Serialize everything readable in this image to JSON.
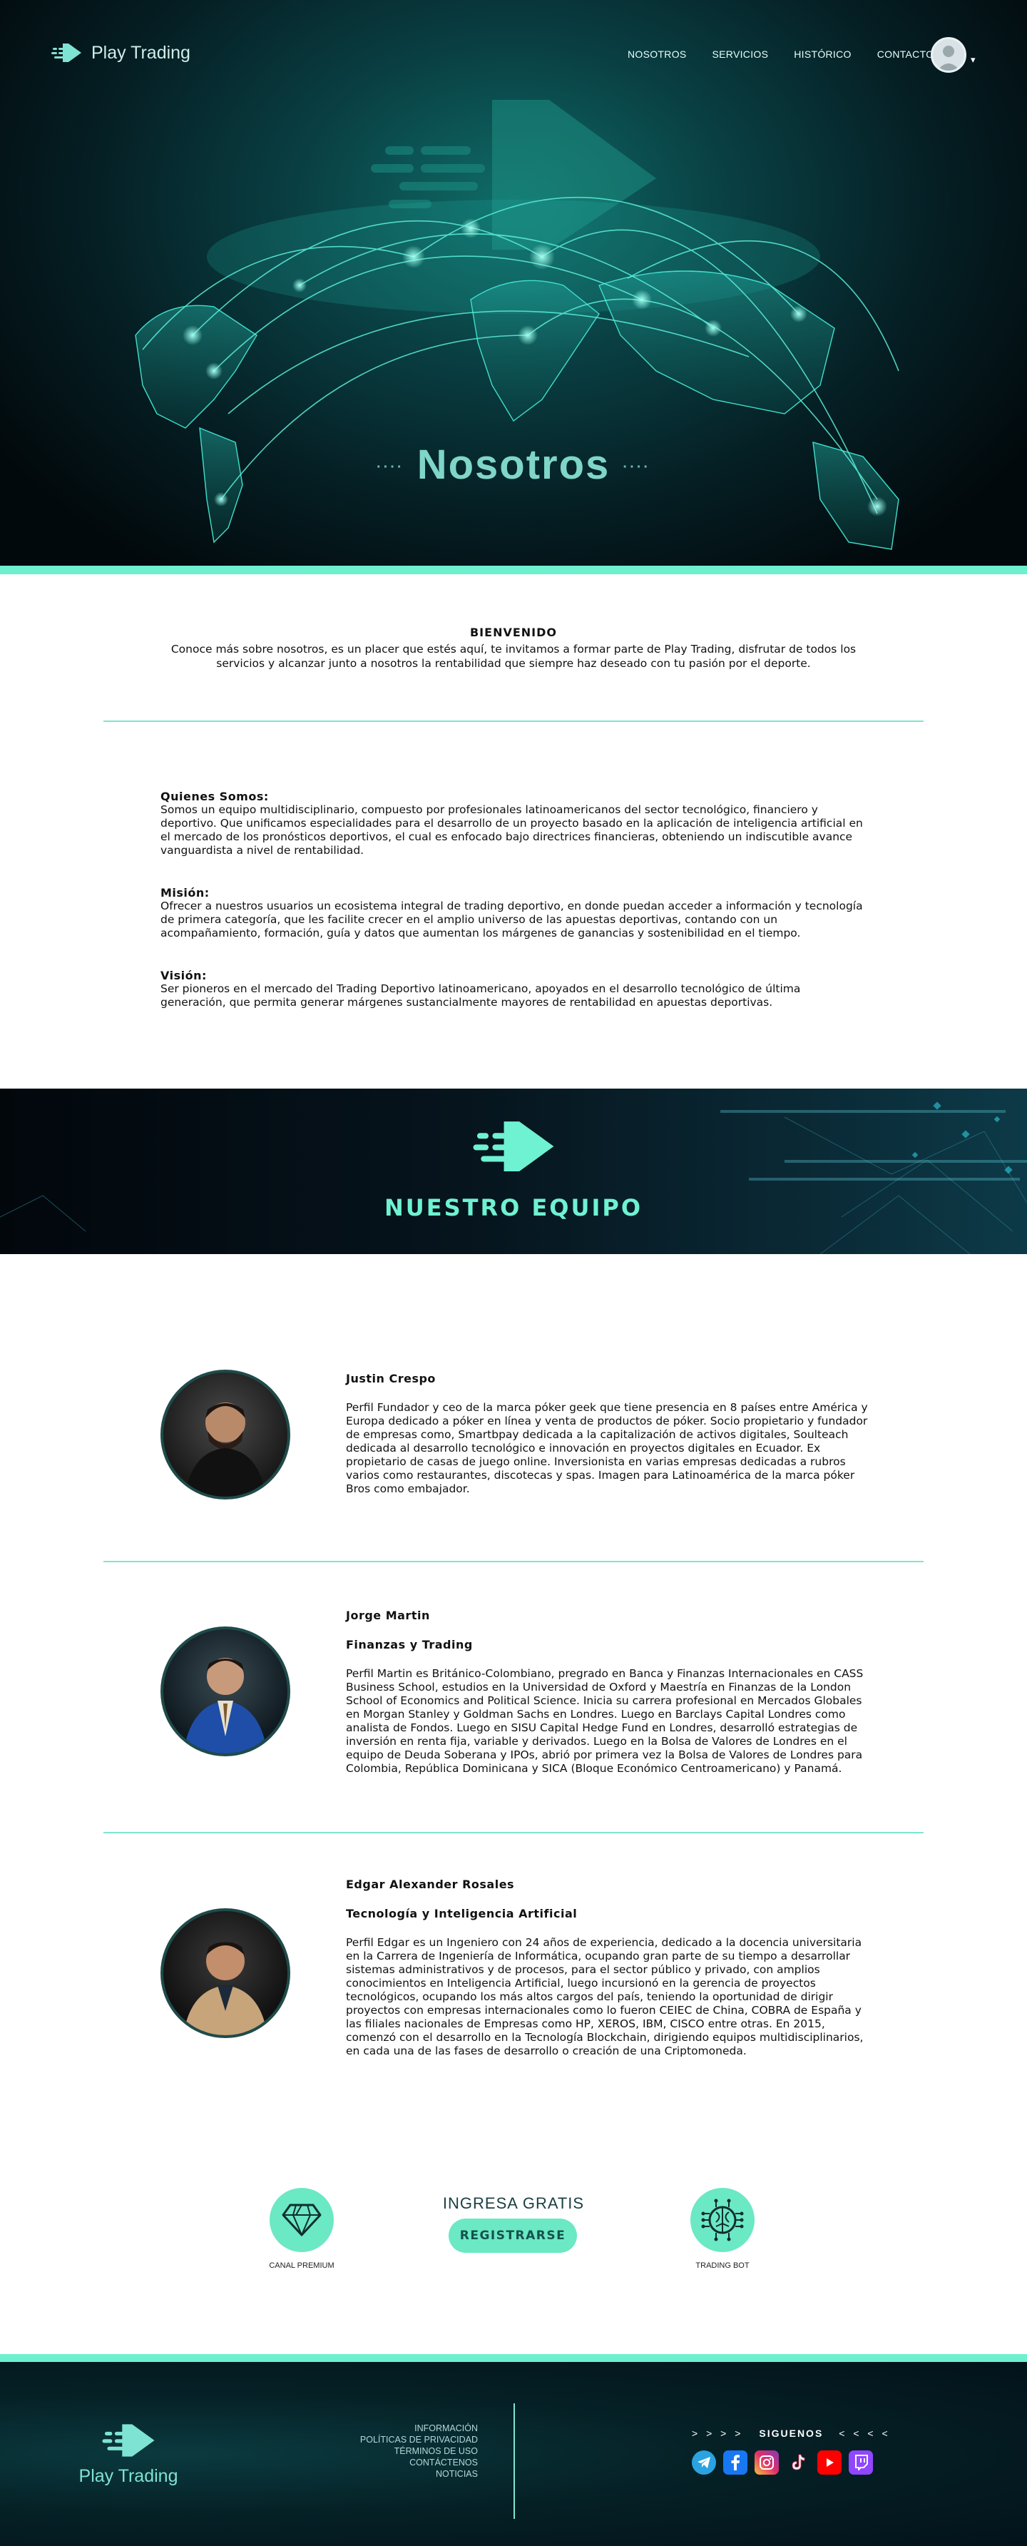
{
  "brand": {
    "name": "Play Trading",
    "accent": "#6ef0cf",
    "dark": "#051f24"
  },
  "nav": {
    "items": [
      {
        "label": "NOSOTROS"
      },
      {
        "label": "SERVICIOS"
      },
      {
        "label": "HISTÓRICO"
      },
      {
        "label": "CONTACTO"
      }
    ],
    "avatar_icon": "user-avatar-icon",
    "caret": "▾"
  },
  "hero": {
    "title": "Nosotros",
    "dots_left": "····",
    "dots_right": "····"
  },
  "intro": {
    "title": "BIENVENIDO",
    "text": "Conoce más sobre nosotros, es un placer que estés aquí, te invitamos a formar parte de Play Trading, disfrutar de todos los servicios y alcanzar junto a nosotros la rentabilidad que siempre haz deseado con tu pasión por el deporte."
  },
  "about": {
    "who": {
      "title": "Quienes Somos:",
      "text": "Somos un equipo multidisciplinario, compuesto por profesionales latinoamericanos del sector tecnológico, financiero y deportivo. Que unificamos especialidades para el desarrollo de un proyecto basado en la aplicación de inteligencia artificial en el mercado de los pronósticos  deportivos, el cual es enfocado bajo directrices financieras, obteniendo un indiscutible avance vanguardista a nivel de rentabilidad."
    },
    "mission": {
      "title": "Misión:",
      "text": "Ofrecer a nuestros usuarios un ecosistema integral de trading deportivo, en donde puedan acceder a información y tecnología de primera categoría, que les facilite crecer en el amplio universo de las apuestas deportivas, contando con un acompañamiento, formación, guía y datos que aumentan los márgenes de ganancias y sostenibilidad en el tiempo."
    },
    "vision": {
      "title": "Visión:",
      "text": "Ser pioneros en el mercado del Trading Deportivo latinoamericano, apoyados en el desarrollo tecnológico de última generación, que permita generar márgenes sustancialmente mayores de rentabilidad en apuestas deportivas."
    }
  },
  "team_banner": {
    "title": "NUESTRO EQUIPO"
  },
  "team": [
    {
      "name": "Justin Crespo",
      "role": "",
      "bio": "Perfil Fundador y ceo de la marca póker geek que tiene presencia en 8 países entre América y Europa dedicado a póker en línea y venta de productos de póker. Socio propietario y fundador de empresas como, Smartbpay dedicada a la capitalización de activos digitales, Soulteach  dedicada al desarrollo tecnológico e innovación en proyectos digitales en Ecuador. Ex propietario de casas de juego online. Inversionista en varias empresas dedicadas a rubros varios como restaurantes, discotecas y spas. Imagen para Latinoamérica de la marca póker Bros como embajador."
    },
    {
      "name": "Jorge Martin",
      "role": "Finanzas y Trading",
      "bio": "Perfil Martin es Británico-Colombiano, pregrado en Banca y Finanzas Internacionales en CASS Business School, estudios en la Universidad de Oxford y Maestría en Finanzas de la London School of Economics and Political Science. Inicia su carrera profesional en Mercados Globales en Morgan Stanley y Goldman Sachs en Londres. Luego en Barclays Capital Londres como analista de Fondos. Luego en SISU Capital Hedge Fund en Londres, desarrolló estrategias de inversión en renta fija, variable y derivados. Luego en la Bolsa de Valores de Londres en el equipo de Deuda Soberana y IPOs, abrió por primera vez la Bolsa de Valores de Londres para Colombia, República Dominicana y SICA (Bloque Económico Centroamericano) y Panamá."
    },
    {
      "name": "Edgar Alexander Rosales",
      "role": "Tecnología y Inteligencia Artificial",
      "bio": "Perfil Edgar es un Ingeniero con 24 años de experiencia, dedicado a la docencia universitaria en la Carrera de Ingeniería de Informática, ocupando gran parte de su tiempo a desarrollar sistemas administrativos y de procesos, para el sector público y privado, con amplios conocimientos en Inteligencia Artificial, luego incursionó en la gerencia de proyectos tecnológicos, ocupando los más altos cargos del país, teniendo la oportunidad de dirigir proyectos con empresas internacionales como lo fueron CEIEC de China, COBRA de España y las filiales nacionales de Empresas como HP, XEROS, IBM, CISCO entre otras. En 2015, comenzó con el desarrollo en la Tecnología Blockchain, dirigiendo equipos multidisciplinarios, en cada una de las fases de desarrollo o creación de una Criptomoneda."
    }
  ],
  "cta": {
    "premium_label": "CANAL PREMIUM",
    "ingresa": "INGRESA GRATIS",
    "register": "REGISTRARSE",
    "bot_label": "TRADING BOT"
  },
  "footer": {
    "brand": "Play Trading",
    "links": [
      {
        "label": "INFORMACIÓN"
      },
      {
        "label": "POLÍTICAS DE PRIVACIDAD"
      },
      {
        "label": "TÉRMINOS DE USO"
      },
      {
        "label": "CONTÁCTENOS"
      },
      {
        "label": "NOTICIAS"
      }
    ],
    "follow_left": "> > > >",
    "follow": "SIGUENOS",
    "follow_right": "< < < <",
    "socials": [
      {
        "icon": "telegram-icon",
        "color": "#2aa3e0"
      },
      {
        "icon": "facebook-icon",
        "color": "#1877f2"
      },
      {
        "icon": "instagram-icon",
        "color": "#e1306c"
      },
      {
        "icon": "tiktok-icon",
        "color": "#111111"
      },
      {
        "icon": "youtube-icon",
        "color": "#ff0000"
      },
      {
        "icon": "twitch-icon",
        "color": "#9146ff"
      }
    ]
  }
}
